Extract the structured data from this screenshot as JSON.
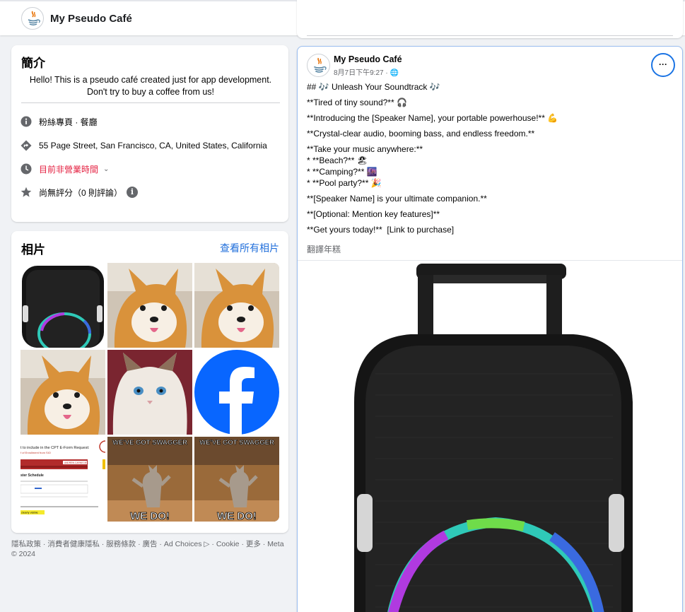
{
  "header": {
    "page_name": "My Pseudo Café",
    "more_label": "···"
  },
  "intro": {
    "title": "簡介",
    "bio": "Hello! This is a pseudo café created just for app development. Don't try to buy a coffee from us!",
    "category": "粉絲專頁 · 餐廳",
    "address": "55 Page Street, San Francisco, CA, United States, California",
    "hours": "目前非營業時間",
    "rating": "尚無評分（0 則評論）",
    "colors": {
      "closed": "#e41e3f"
    }
  },
  "photos": {
    "title": "相片",
    "see_all": "查看所有相片",
    "tiles": [
      {
        "name": "speaker-photo"
      },
      {
        "name": "shiba-photo"
      },
      {
        "name": "shiba-photo"
      },
      {
        "name": "shiba-photo"
      },
      {
        "name": "cat-photo"
      },
      {
        "name": "facebook-logo-photo"
      },
      {
        "name": "document-screenshot-photo"
      },
      {
        "name": "swagger-cat-meme-photo"
      },
      {
        "name": "swagger-cat-meme-photo"
      }
    ],
    "meme_top": "WE'VE GOT SWAGGER",
    "meme_bottom": "WE DO!",
    "doc_heading": "t to include in the CPT E-Form Request:",
    "doc_sub": "f of Enrollment from SIO",
    "doc_badge": "ANDREW CARNEGIE",
    "doc_schedule": "ster Schedule",
    "doc_note": "clearly visible"
  },
  "footer": {
    "text": "隱私政策 · 消費者健康隱私 · 服務條款 · 廣告 · Ad Choices ▷ · Cookie · 更多 · Meta © 2024"
  },
  "post": {
    "author": "My Pseudo Café",
    "time": "8月7日下午9:27 · 🌐",
    "more_label": "···",
    "lines": [
      "## 🎶 Unleash Your Soundtrack 🎶",
      "**Tired of tiny sound?** 🎧",
      "**Introducing the [Speaker Name], your portable powerhouse!** 💪",
      "**Crystal-clear audio, booming bass, and endless freedom.**",
      "**Take your music anywhere:**",
      "* **Beach?** 🏖",
      "* **Camping?** 🌆",
      "* **Pool party?** 🎉",
      "**[Speaker Name] is your ultimate companion.**",
      "**[Optional: Mention key features]**",
      "**Get yours today!**  [Link to purchase]"
    ],
    "translate_label": "翻譯年糕",
    "image_name": "portable speaker product image"
  },
  "colors": {
    "accent": "#216fdb",
    "focus_ring": "#1b74e4",
    "facebook_blue": "#0866ff"
  }
}
